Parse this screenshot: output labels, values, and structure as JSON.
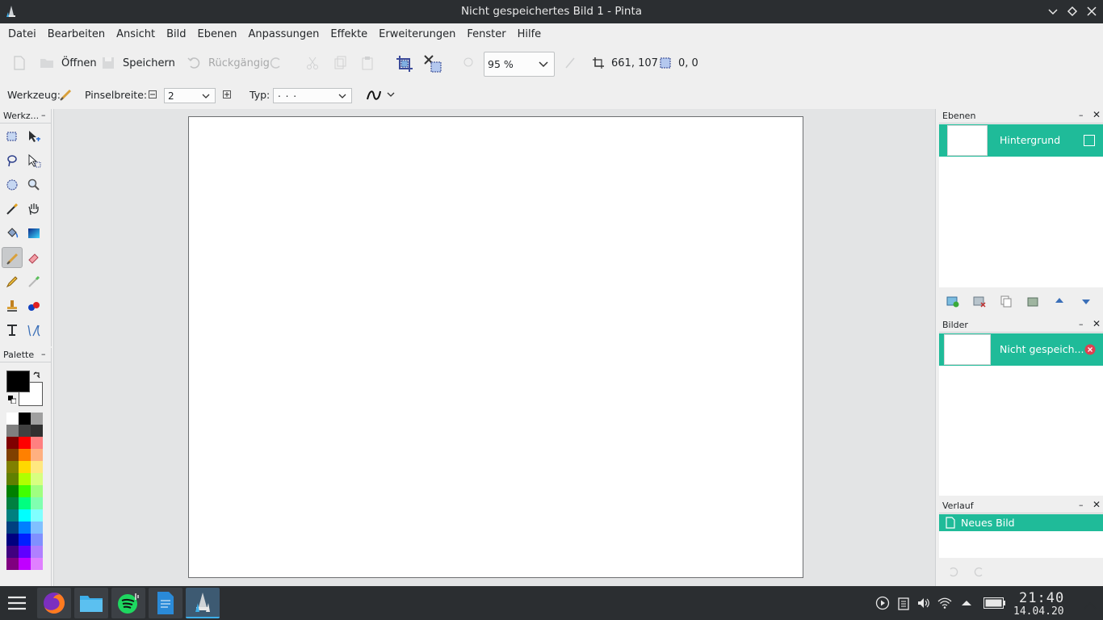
{
  "window": {
    "title": "Nicht gespeichertes Bild 1 - Pinta"
  },
  "menu": [
    "Datei",
    "Bearbeiten",
    "Ansicht",
    "Bild",
    "Ebenen",
    "Anpassungen",
    "Effekte",
    "Erweiterungen",
    "Fenster",
    "Hilfe"
  ],
  "toolbar": {
    "open_label": "Öffnen",
    "save_label": "Speichern",
    "undo_label": "Rückgängig",
    "zoom_value": "95 %",
    "cursor_position": "661, 107",
    "selection_size": "0, 0"
  },
  "tool_options": {
    "tool_label": "Werkzeug:",
    "brush_width_label": "Pinselbreite:",
    "brush_width_value": "2",
    "type_label": "Typ:",
    "type_value": ". .       ."
  },
  "panels": {
    "tools_title": "Werkz...",
    "palette_title": "Palette",
    "layers_title": "Ebenen",
    "layer_name": "Hintergrund",
    "images_title": "Bilder",
    "image_name": "Nicht gespeich...",
    "history_title": "Verlauf",
    "history_item": "Neues Bild"
  },
  "colors": {
    "primary": "#000000",
    "secondary": "#ffffff",
    "accent": "#1fbb99",
    "palette": [
      "#ffffff",
      "#000000",
      "#a0a0a0",
      "#808080",
      "#404040",
      "#303030",
      "#800000",
      "#ff0000",
      "#ff8080",
      "#804000",
      "#ff8000",
      "#ffb080",
      "#808000",
      "#ffd800",
      "#ffe880",
      "#608000",
      "#b0ff00",
      "#d8ff80",
      "#008000",
      "#40ff00",
      "#a0ff80",
      "#008040",
      "#00ff80",
      "#80ffb0",
      "#008080",
      "#00ffff",
      "#80ffff",
      "#004080",
      "#0080ff",
      "#80c0ff",
      "#000080",
      "#0020ff",
      "#8090ff",
      "#400080",
      "#6000ff",
      "#b080ff",
      "#800080",
      "#c000ff",
      "#e080ff"
    ]
  },
  "taskbar": {
    "time": "21:40",
    "date": "14.04.20"
  }
}
